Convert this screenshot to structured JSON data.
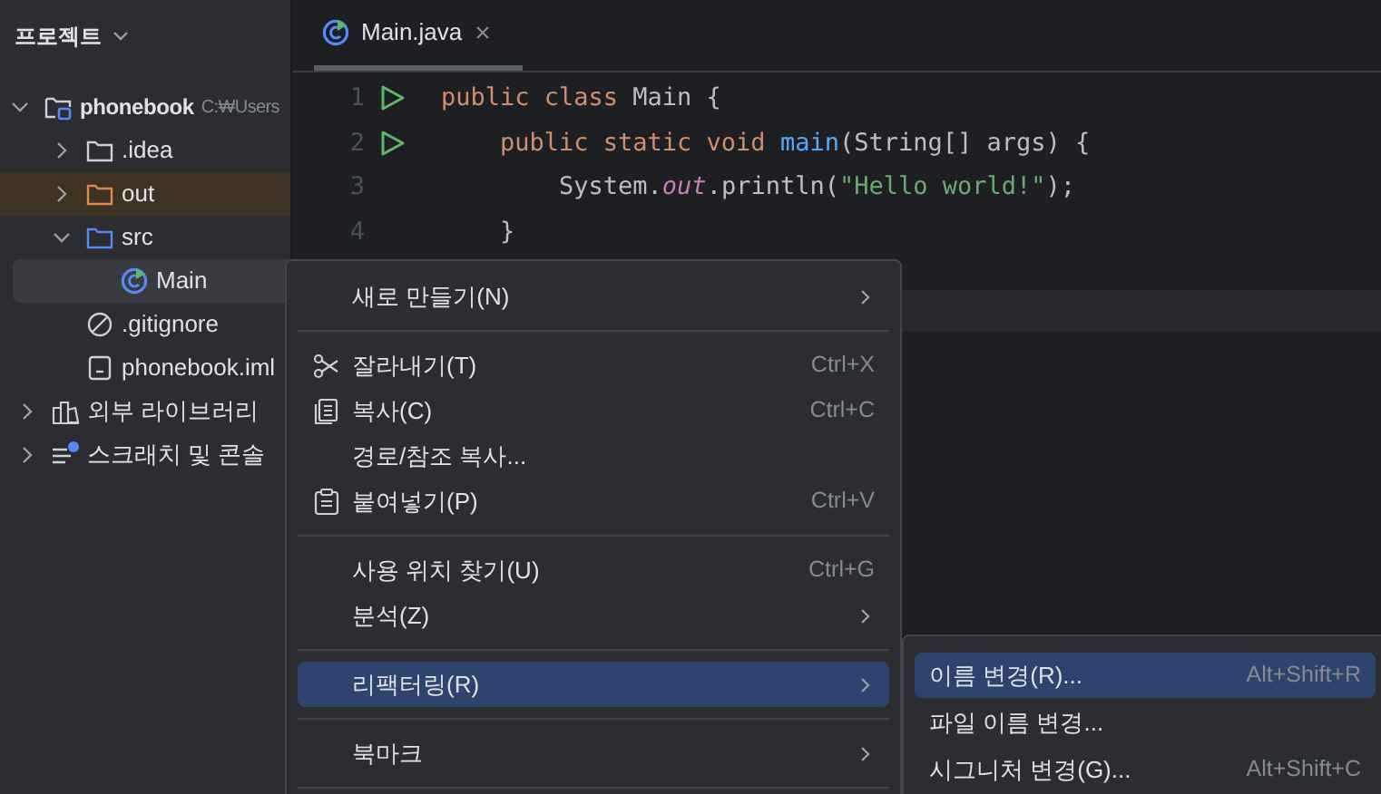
{
  "project_panel": {
    "title": "프로젝트",
    "tree": [
      {
        "kind": "module",
        "label": "phonebook",
        "path": "C:₩Users",
        "expanded": true,
        "selected": false,
        "children": [
          {
            "kind": "folder",
            "label": ".idea",
            "expanded": false,
            "selected": false
          },
          {
            "kind": "excluded_folder",
            "label": "out",
            "expanded": false,
            "selected": false
          },
          {
            "kind": "source_folder",
            "label": "src",
            "expanded": true,
            "selected": false,
            "children": [
              {
                "kind": "class",
                "label": "Main",
                "selected": true
              }
            ]
          },
          {
            "kind": "ignore_file",
            "label": ".gitignore",
            "selected": false
          },
          {
            "kind": "module_file",
            "label": "phonebook.iml",
            "selected": false
          }
        ]
      },
      {
        "kind": "libraries",
        "label": "외부 라이브러리",
        "expanded": false,
        "selected": false
      },
      {
        "kind": "scratches",
        "label": "스크래치 및 콘솔",
        "expanded": false,
        "selected": false
      }
    ]
  },
  "editor": {
    "tab": {
      "label": "Main.java"
    },
    "lines": [
      {
        "number": "1",
        "run": true,
        "tokens": [
          {
            "kind": "keyword",
            "text": "public class "
          },
          {
            "kind": "plain",
            "text": "Main {"
          }
        ]
      },
      {
        "number": "2",
        "run": true,
        "tokens": [
          {
            "kind": "keyword",
            "text": "    public static void "
          },
          {
            "kind": "method",
            "text": "main"
          },
          {
            "kind": "plain",
            "text": "(String[] args) {"
          }
        ]
      },
      {
        "number": "3",
        "run": false,
        "tokens": [
          {
            "kind": "plain",
            "text": "        System."
          },
          {
            "kind": "field",
            "text": "out"
          },
          {
            "kind": "plain",
            "text": ".println("
          },
          {
            "kind": "string",
            "text": "\"Hello world!\""
          },
          {
            "kind": "plain",
            "text": ");"
          }
        ]
      },
      {
        "number": "4",
        "run": false,
        "tokens": [
          {
            "kind": "plain",
            "text": "    }"
          }
        ]
      }
    ]
  },
  "context_menu": {
    "items": [
      {
        "kind": "plain",
        "label": "새로 만들기(N)",
        "submenu": true,
        "selected": false
      },
      {
        "kind": "separator"
      },
      {
        "kind": "cut",
        "label": "잘라내기(T)",
        "shortcut": "Ctrl+X",
        "submenu": false,
        "selected": false
      },
      {
        "kind": "copy",
        "label": "복사(C)",
        "shortcut": "Ctrl+C",
        "submenu": false,
        "selected": false
      },
      {
        "kind": "plain",
        "label": "경로/참조 복사...",
        "submenu": false,
        "selected": false
      },
      {
        "kind": "paste",
        "label": "붙여넣기(P)",
        "shortcut": "Ctrl+V",
        "submenu": false,
        "selected": false
      },
      {
        "kind": "separator"
      },
      {
        "kind": "plain",
        "label": "사용 위치 찾기(U)",
        "shortcut": "Ctrl+G",
        "submenu": false,
        "selected": false
      },
      {
        "kind": "plain",
        "label": "분석(Z)",
        "submenu": true,
        "selected": false
      },
      {
        "kind": "separator"
      },
      {
        "kind": "plain",
        "label": "리팩터링(R)",
        "submenu": true,
        "selected": true
      },
      {
        "kind": "separator"
      },
      {
        "kind": "plain",
        "label": "북마크",
        "submenu": true,
        "selected": false
      },
      {
        "kind": "separator"
      }
    ]
  },
  "submenu": {
    "items": [
      {
        "label": "이름 변경(R)...",
        "shortcut": "Alt+Shift+R",
        "selected": true
      },
      {
        "label": "파일 이름 변경...",
        "selected": false
      },
      {
        "label": "시그니처 변경(G)...",
        "shortcut": "Alt+Shift+C",
        "selected": false
      }
    ]
  }
}
